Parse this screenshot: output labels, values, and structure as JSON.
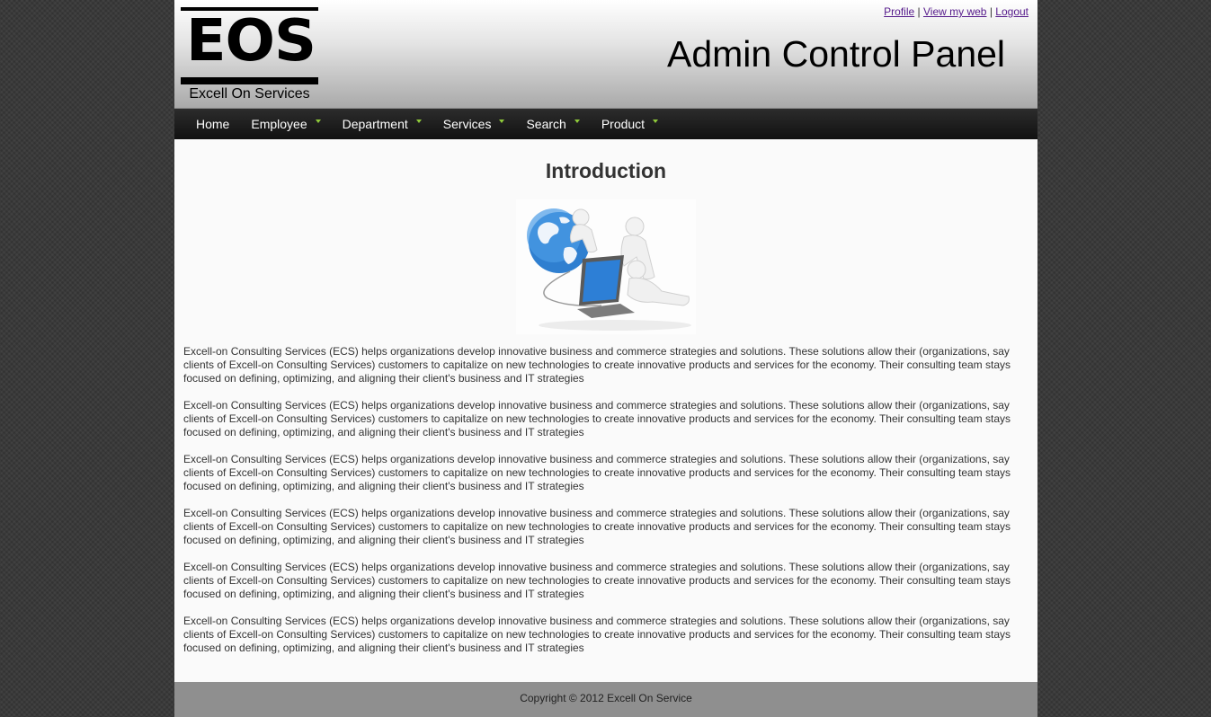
{
  "header": {
    "logo_mark": "EOS",
    "logo_tagline": "Excell On Services",
    "title": "Admin Control Panel",
    "links": [
      {
        "label": "Profile"
      },
      {
        "label": "View my web"
      },
      {
        "label": "Logout"
      }
    ],
    "link_separator": "|"
  },
  "nav": {
    "items": [
      {
        "label": "Home",
        "has_dropdown": false
      },
      {
        "label": "Employee",
        "has_dropdown": true
      },
      {
        "label": "Department",
        "has_dropdown": true
      },
      {
        "label": "Services",
        "has_dropdown": true
      },
      {
        "label": "Search",
        "has_dropdown": true
      },
      {
        "label": "Product",
        "has_dropdown": true
      }
    ],
    "arrow_color": "#8fc93a"
  },
  "main": {
    "heading": "Introduction",
    "paragraphs": [
      "Excell-on Consulting Services (ECS) helps organizations develop innovative business and commerce strategies and solutions. These solutions allow their (organizations, say clients of Excell-on Consulting Services) customers to capitalize on new technologies to create innovative products and services for the economy. Their consulting team stays focused on defining, optimizing, and aligning their client's business and IT strategies",
      "Excell-on Consulting Services (ECS) helps organizations develop innovative business and commerce strategies and solutions. These solutions allow their (organizations, say clients of Excell-on Consulting Services) customers to capitalize on new technologies to create innovative products and services for the economy. Their consulting team stays focused on defining, optimizing, and aligning their client's business and IT strategies",
      "Excell-on Consulting Services (ECS) helps organizations develop innovative business and commerce strategies and solutions. These solutions allow their (organizations, say clients of Excell-on Consulting Services) customers to capitalize on new technologies to create innovative products and services for the economy. Their consulting team stays focused on defining, optimizing, and aligning their client's business and IT strategies",
      "Excell-on Consulting Services (ECS) helps organizations develop innovative business and commerce strategies and solutions. These solutions allow their (organizations, say clients of Excell-on Consulting Services) customers to capitalize on new technologies to create innovative products and services for the economy. Their consulting team stays focused on defining, optimizing, and aligning their client's business and IT strategies",
      "Excell-on Consulting Services (ECS) helps organizations develop innovative business and commerce strategies and solutions. These solutions allow their (organizations, say clients of Excell-on Consulting Services) customers to capitalize on new technologies to create innovative products and services for the economy. Their consulting team stays focused on defining, optimizing, and aligning their client's business and IT strategies",
      "Excell-on Consulting Services (ECS) helps organizations develop innovative business and commerce strategies and solutions. These solutions allow their (organizations, say clients of Excell-on Consulting Services) customers to capitalize on new technologies to create innovative products and services for the economy. Their consulting team stays focused on defining, optimizing, and aligning their client's business and IT strategies"
    ]
  },
  "footer": {
    "copyright": "Copyright © 2012 Excell On Service"
  }
}
